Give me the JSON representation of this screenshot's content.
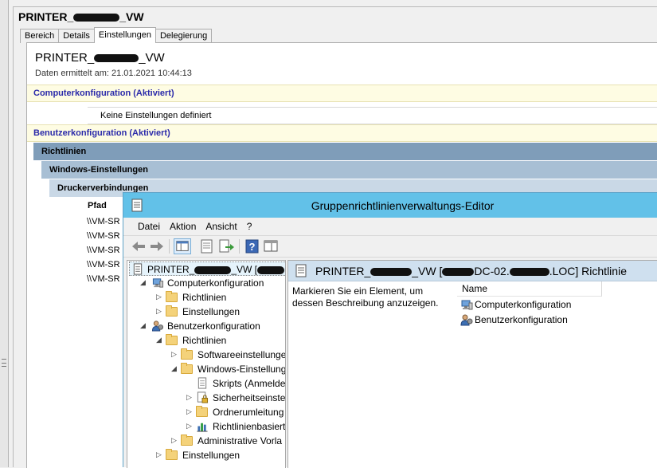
{
  "gpmc": {
    "title": "PRINTER_",
    "title_suffix": "_VW",
    "tabs": [
      {
        "label": "Bereich",
        "active": false
      },
      {
        "label": "Details",
        "active": false
      },
      {
        "label": "Einstellungen",
        "active": true
      },
      {
        "label": "Delegierung",
        "active": false
      }
    ],
    "report": {
      "name_prefix": "PRINTER_",
      "name_suffix": "_VW",
      "date_text": "Daten ermittelt am: 21.01.2021 10:44:13",
      "computer_config": "Computerkonfiguration (Aktiviert)",
      "no_settings": "Keine Einstellungen definiert",
      "user_config": "Benutzerkonfiguration (Aktiviert)",
      "richtlinien": "Richtlinien",
      "windows_settings": "Windows-Einstellungen",
      "printer_connections": "Druckerverbindungen",
      "pfad_header": "Pfad",
      "pfad_rows": [
        "\\\\VM-SR",
        "\\\\VM-SR",
        "\\\\VM-SR",
        "\\\\VM-SR",
        "\\\\VM-SR"
      ]
    }
  },
  "editor": {
    "title": "Gruppenrichtlinienverwaltungs-Editor",
    "menu": [
      "Datei",
      "Aktion",
      "Ansicht",
      "?"
    ],
    "toolbar_icons": [
      "back-icon",
      "forward-icon",
      "show-hide-tree-icon",
      "properties-icon",
      "export-list-icon",
      "help-icon",
      "extended-view-icon"
    ],
    "tree": {
      "root_prefix": "PRINTER_",
      "root_suffix": "_VW [",
      "items": [
        {
          "label": "Computerkonfiguration",
          "level": 1,
          "expander": "◢",
          "icon": "computer-icon"
        },
        {
          "label": "Richtlinien",
          "level": 2,
          "expander": "▷",
          "icon": "folder-icon"
        },
        {
          "label": "Einstellungen",
          "level": 2,
          "expander": "▷",
          "icon": "folder-icon"
        },
        {
          "label": "Benutzerkonfiguration",
          "level": 1,
          "expander": "◢",
          "icon": "user-config-icon"
        },
        {
          "label": "Richtlinien",
          "level": 2,
          "expander": "◢",
          "icon": "folder-icon"
        },
        {
          "label": "Softwareeinstellunge",
          "level": 3,
          "expander": "▷",
          "icon": "folder-icon"
        },
        {
          "label": "Windows-Einstellung",
          "level": 3,
          "expander": "◢",
          "icon": "folder-icon"
        },
        {
          "label": "Skripts (Anmelde",
          "level": 4,
          "expander": "",
          "icon": "script-icon"
        },
        {
          "label": "Sicherheitseinstel",
          "level": 4,
          "expander": "▷",
          "icon": "security-icon"
        },
        {
          "label": "Ordnerumleitung",
          "level": 4,
          "expander": "▷",
          "icon": "folder-icon"
        },
        {
          "label": "Richtlinienbasiert",
          "level": 4,
          "expander": "▷",
          "icon": "qos-chart-icon"
        },
        {
          "label": "Administrative Vorla",
          "level": 3,
          "expander": "▷",
          "icon": "folder-icon"
        },
        {
          "label": "Einstellungen",
          "level": 2,
          "expander": "▷",
          "icon": "folder-icon"
        }
      ]
    },
    "right": {
      "header_prefix": "PRINTER_",
      "header_mid1": "_VW [",
      "header_mid2": "DC-02.",
      "header_suffix": ".LOC] Richtlinie",
      "description": "Markieren Sie ein Element, um dessen Beschreibung anzuzeigen.",
      "column_name": "Name",
      "items": [
        {
          "label": "Computerkonfiguration",
          "icon": "computer-icon"
        },
        {
          "label": "Benutzerkonfiguration",
          "icon": "user-config-icon"
        }
      ]
    }
  },
  "colors": {
    "titlebar": "#62c1e8",
    "config_band": "#fefce3",
    "config_text": "#2b2aaa",
    "band_richtlinien": "#7f9db9",
    "band_windows": "#a8bfd4",
    "band_drucker": "#c9d8e6"
  }
}
